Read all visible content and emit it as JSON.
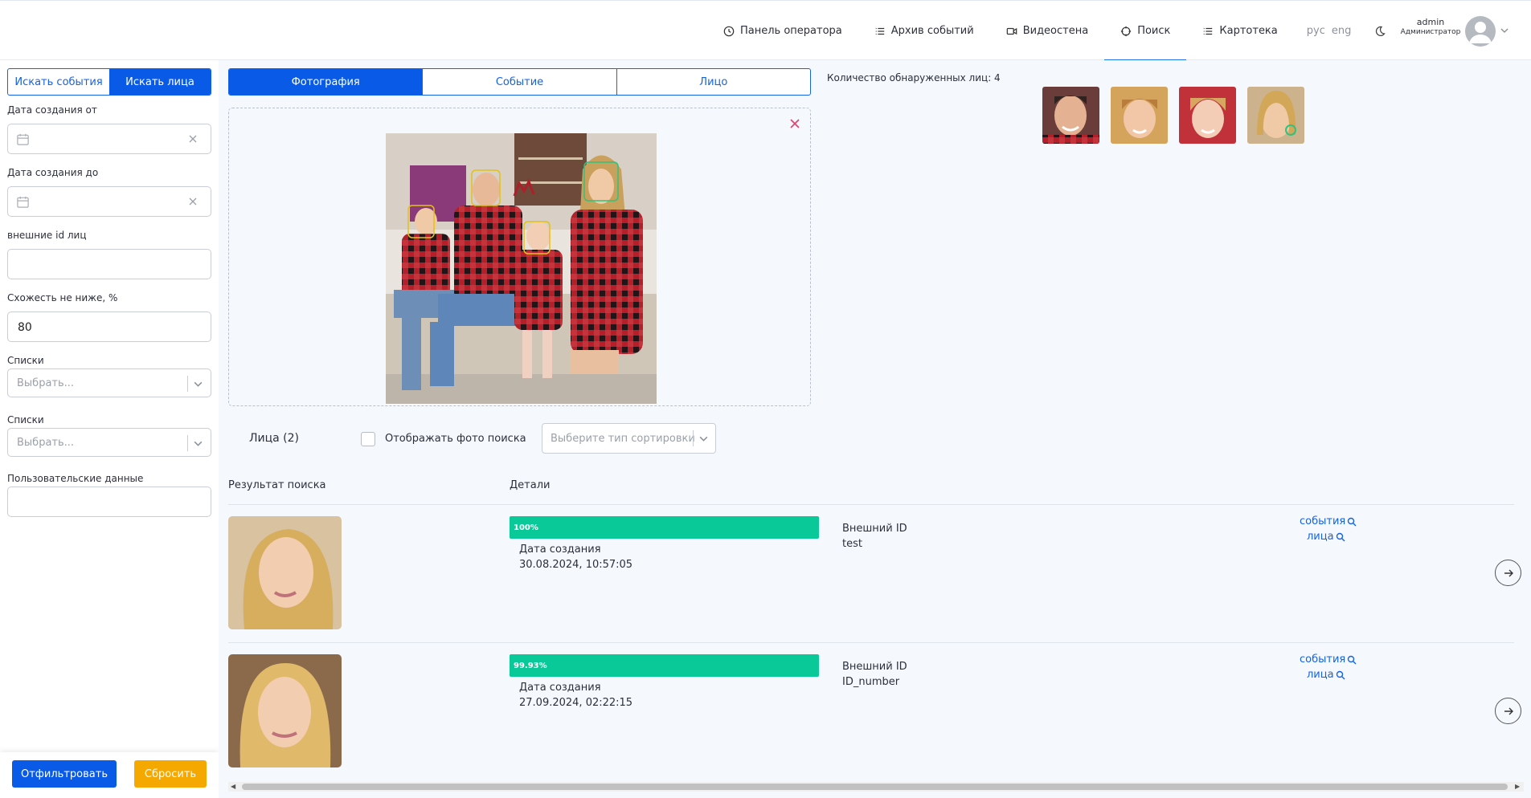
{
  "header": {
    "nav": [
      {
        "label": "Панель оператора",
        "icon": "clock-icon"
      },
      {
        "label": "Архив событий",
        "icon": "list-icon"
      },
      {
        "label": "Видеостена",
        "icon": "video-icon"
      },
      {
        "label": "Поиск",
        "icon": "search-crosshair-icon",
        "active": true
      },
      {
        "label": "Картотека",
        "icon": "list-icon"
      }
    ],
    "lang": [
      "рус",
      "eng"
    ],
    "user": {
      "name": "admin",
      "role": "Администратор"
    }
  },
  "left": {
    "mode_tabs": [
      "Искать события",
      "Искать лица"
    ],
    "active_mode": "Искать лица",
    "date_from_label": "Дата создания от",
    "date_to_label": "Дата создания до",
    "external_ids_label": "внешние id лиц",
    "similarity_label": "Схожесть не ниже, %",
    "similarity_value": "80",
    "lists1_label": "Списки",
    "lists1_placeholder": "Выбрать...",
    "lists2_label": "Списки",
    "lists2_placeholder": "Выбрать...",
    "user_data_label": "Пользовательские данные",
    "filter_button": "Отфильтровать",
    "reset_button": "Сбросить"
  },
  "main": {
    "tabs": [
      "Фотография",
      "Событие",
      "Лицо"
    ],
    "active_tab": "Фотография",
    "faces_count_text": "Количество обнаруженных лиц: 4",
    "faces_title": "Лица (2)",
    "show_search_photo_label": "Отображать фото поиска",
    "sort_placeholder": "Выберите тип сортировки",
    "col_result": "Результат поиска",
    "col_details": "Детали",
    "results": [
      {
        "similarity": "100%",
        "similarity_value": 1.0,
        "date_label": "Дата создания",
        "date_value": "30.08.2024, 10:57:05",
        "ext_id_label": "Внешний ID",
        "ext_id_value": "test",
        "events_link": "события",
        "faces_link": "лица"
      },
      {
        "similarity": "99.93%",
        "similarity_value": 0.9993,
        "date_label": "Дата создания",
        "date_value": "27.09.2024, 02:22:15",
        "ext_id_label": "Внешний ID",
        "ext_id_value": "ID_number",
        "events_link": "события",
        "faces_link": "лица"
      }
    ]
  },
  "colors": {
    "primary": "#0a5ae8",
    "accent_orange": "#f5a800",
    "match_green": "#08c997",
    "close_red": "#e0406a"
  }
}
